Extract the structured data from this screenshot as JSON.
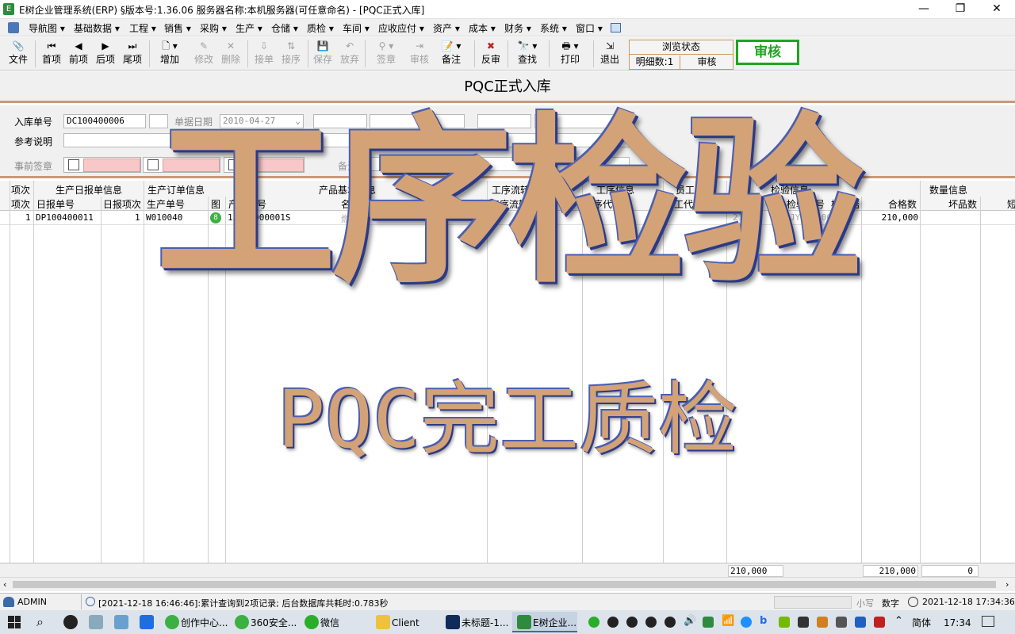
{
  "window": {
    "title": "E树企业管理系统(ERP) §版本号:1.36.06  服务器名称:本机服务器(可任意命名) - [PQC正式入库]",
    "minimize": "—",
    "restore": "❐",
    "close": "✕"
  },
  "menu": [
    "导航图 ▾",
    "基础数据 ▾",
    "工程 ▾",
    "销售 ▾",
    "采购 ▾",
    "生产 ▾",
    "仓储 ▾",
    "质检 ▾",
    "车间 ▾",
    "应收应付 ▾",
    "资产 ▾",
    "成本 ▾",
    "财务 ▾",
    "系统 ▾",
    "窗口 ▾"
  ],
  "toolbar": {
    "file": "文件",
    "first": "首项",
    "prev": "前项",
    "next": "后项",
    "last": "尾项",
    "add": "增加",
    "edit": "修改",
    "delete": "删除",
    "insert": "接单",
    "sort": "接序",
    "save": "保存",
    "discard": "放弃",
    "sign": "签章",
    "review": "审核",
    "note": "备注",
    "unaudit": "反审",
    "find": "查找",
    "print": "打印",
    "exit": "退出"
  },
  "browse": {
    "title": "浏览状态",
    "detail": "明细数:1",
    "state": "审核"
  },
  "audit_button": "审核",
  "form": {
    "title": "PQC正式入库",
    "label_no": "入库单号",
    "value_no": "DC100400006",
    "label_date": "单据日期",
    "value_date": "2010-04-27",
    "label_ref": "参考说明",
    "label_sign": "事前签章",
    "label_note": "备注"
  },
  "grid": {
    "group_headers": {
      "item": "项次",
      "report": "生产日报单信息",
      "order": "生产订单信息",
      "product": "产品基本信息",
      "flow": "工序流转信息",
      "proc": "工序信息",
      "staff": "员工信息",
      "insp": "检验信息",
      "qty": "数量信息"
    },
    "columns": {
      "item": "项次",
      "report_no": "日报单号",
      "report_item": "日报项次",
      "order_no": "生产单号",
      "img": "图",
      "product_no": "产品编号",
      "product_name": "名称",
      "unit": "单位",
      "flow_no": "工序流转",
      "proc_no": "工序代号",
      "staff_no": "员工代号",
      "insp_qty": "送检数",
      "insp_no": "检验单号",
      "inspector": "检验结",
      "ok_qty": "合格数",
      "bad_qty": "坏品数",
      "short": "短"
    },
    "rows": [
      {
        "item": "1",
        "report_no": "DP100400011",
        "report_item": "1",
        "order_no": "W010040",
        "img": "8",
        "product_no": "13R1-000001S",
        "product_name": "燃",
        "insp_qty": "210",
        "insp_no": "JY1004000",
        "inspector": "接",
        "ok_qty": "210,000"
      }
    ],
    "totals": {
      "insp": "210,000",
      "ok": "210,000",
      "bad": "0"
    }
  },
  "status": {
    "user": "ADMIN",
    "message": "[2021-12-18 16:46:46]:累计查询到2项记录; 后台数据库共耗时:0.783秒",
    "caps": "小写",
    "num": "数字",
    "clock": "2021-12-18 17:34:36"
  },
  "taskbar": {
    "apps": [
      "创作中心...",
      "360安全...",
      "微信",
      "Client",
      "未标题-1...",
      "E树企业..."
    ],
    "ime": "简体",
    "time": "17:34"
  },
  "overlay": {
    "main": "工序检验",
    "sub": "PQC完工质检"
  }
}
